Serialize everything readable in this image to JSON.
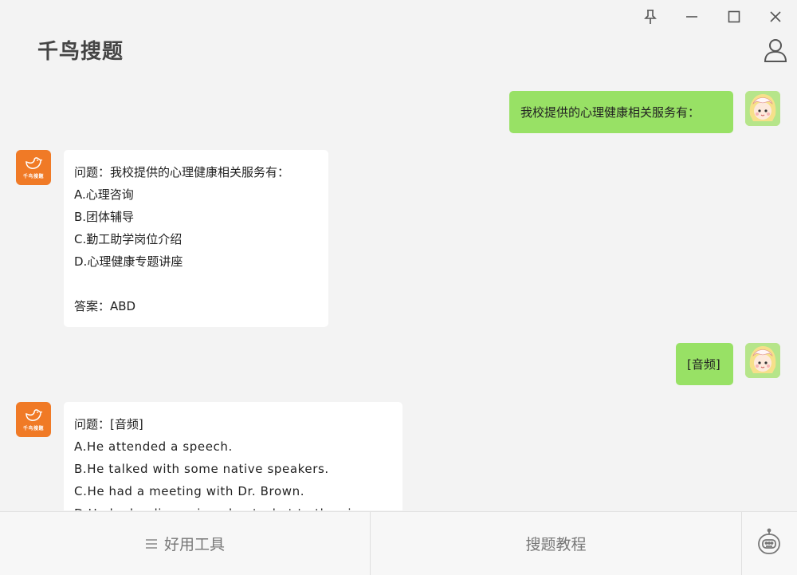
{
  "app": {
    "title": "千鸟搜题"
  },
  "window_controls": [
    "pin-icon",
    "minimize-icon",
    "maximize-icon",
    "close-icon"
  ],
  "bot_avatar_label": "千鸟搜题",
  "messages": [
    {
      "from": "user",
      "text": "我校提供的心理健康相关服务有："
    },
    {
      "from": "bot",
      "lines": [
        "问题：我校提供的心理健康相关服务有：",
        "A.心理咨询",
        "B.团体辅导",
        "C.勤工助学岗位介绍",
        "D.心理健康专题讲座",
        "",
        "答案：ABD"
      ]
    },
    {
      "from": "user",
      "text": "[音频]"
    },
    {
      "from": "bot",
      "lines": [
        "问题：[音频]",
        "A.He attended a speech.",
        "B.He talked with some native speakers.",
        "C.He had a meeting with Dr. Brown.",
        "D.He had a discussion about what to the vi"
      ]
    }
  ],
  "bottom_bar": {
    "tools_label": "好用工具",
    "tutorial_label": "搜题教程"
  },
  "colors": {
    "user_bubble": "#98e165",
    "bot_bubble": "#ffffff",
    "bot_avatar": "#f07a26",
    "background": "#f3f3f3"
  }
}
